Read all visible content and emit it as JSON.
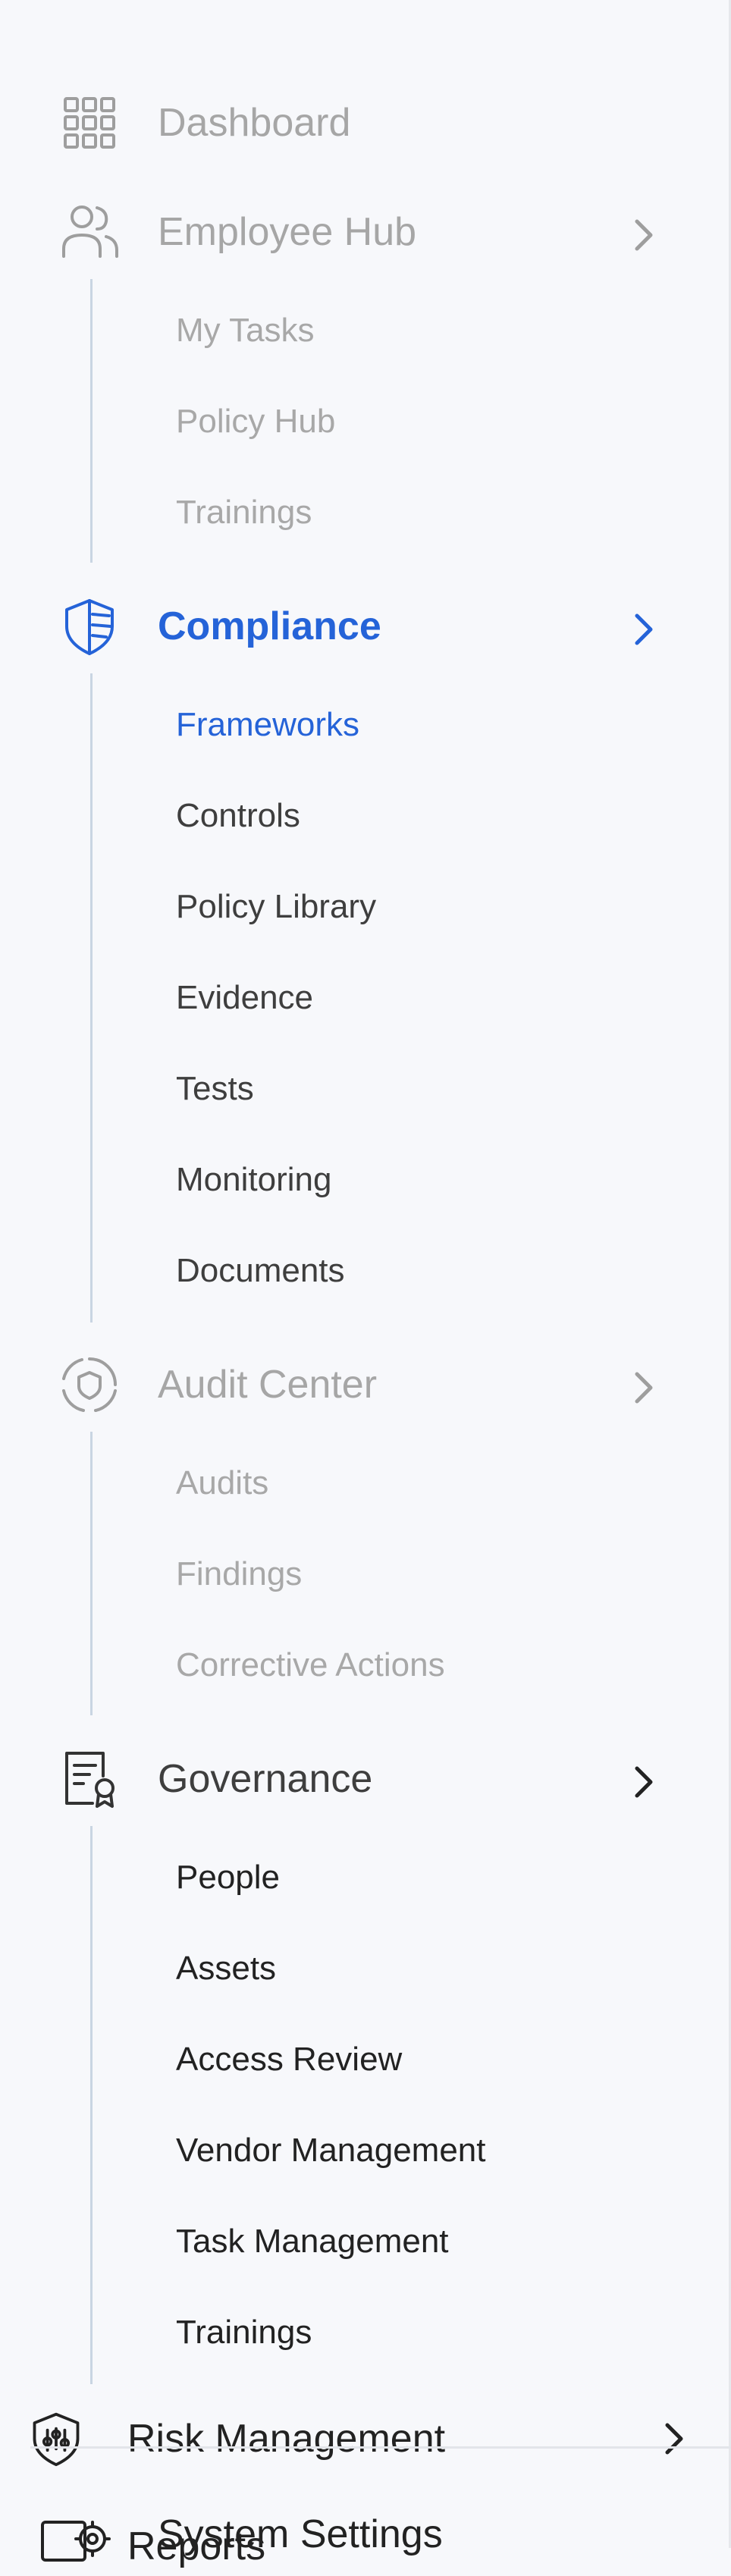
{
  "nav": {
    "dashboard": {
      "label": "Dashboard",
      "icon": "grid-icon"
    },
    "employee_hub": {
      "label": "Employee Hub",
      "icon": "users-icon",
      "items": [
        "My Tasks",
        "Policy Hub",
        "Trainings"
      ]
    },
    "compliance": {
      "label": "Compliance",
      "icon": "shield-icon",
      "active_item": "Frameworks",
      "items": [
        "Frameworks",
        "Controls",
        "Policy Library",
        "Evidence",
        "Tests",
        "Monitoring",
        "Documents"
      ]
    },
    "audit_center": {
      "label": "Audit Center",
      "icon": "audit-target-icon",
      "items": [
        "Audits",
        "Findings",
        "Corrective Actions"
      ]
    },
    "governance": {
      "label": "Governance",
      "icon": "document-badge-icon",
      "items": [
        "People",
        "Assets",
        "Access Review",
        "Vendor Management",
        "Task Management",
        "Trainings"
      ]
    },
    "risk_management": {
      "label": "Risk Management",
      "icon": "shield-sliders-icon"
    },
    "system_settings": {
      "label": "System Settings",
      "icon": "settings-icon"
    },
    "overlap_label": "Reports"
  },
  "colors": {
    "active": "#2563d8",
    "muted": "#a6a6a6",
    "text": "#3e3e3e",
    "dark": "#222222",
    "line": "#c9d5e2"
  }
}
